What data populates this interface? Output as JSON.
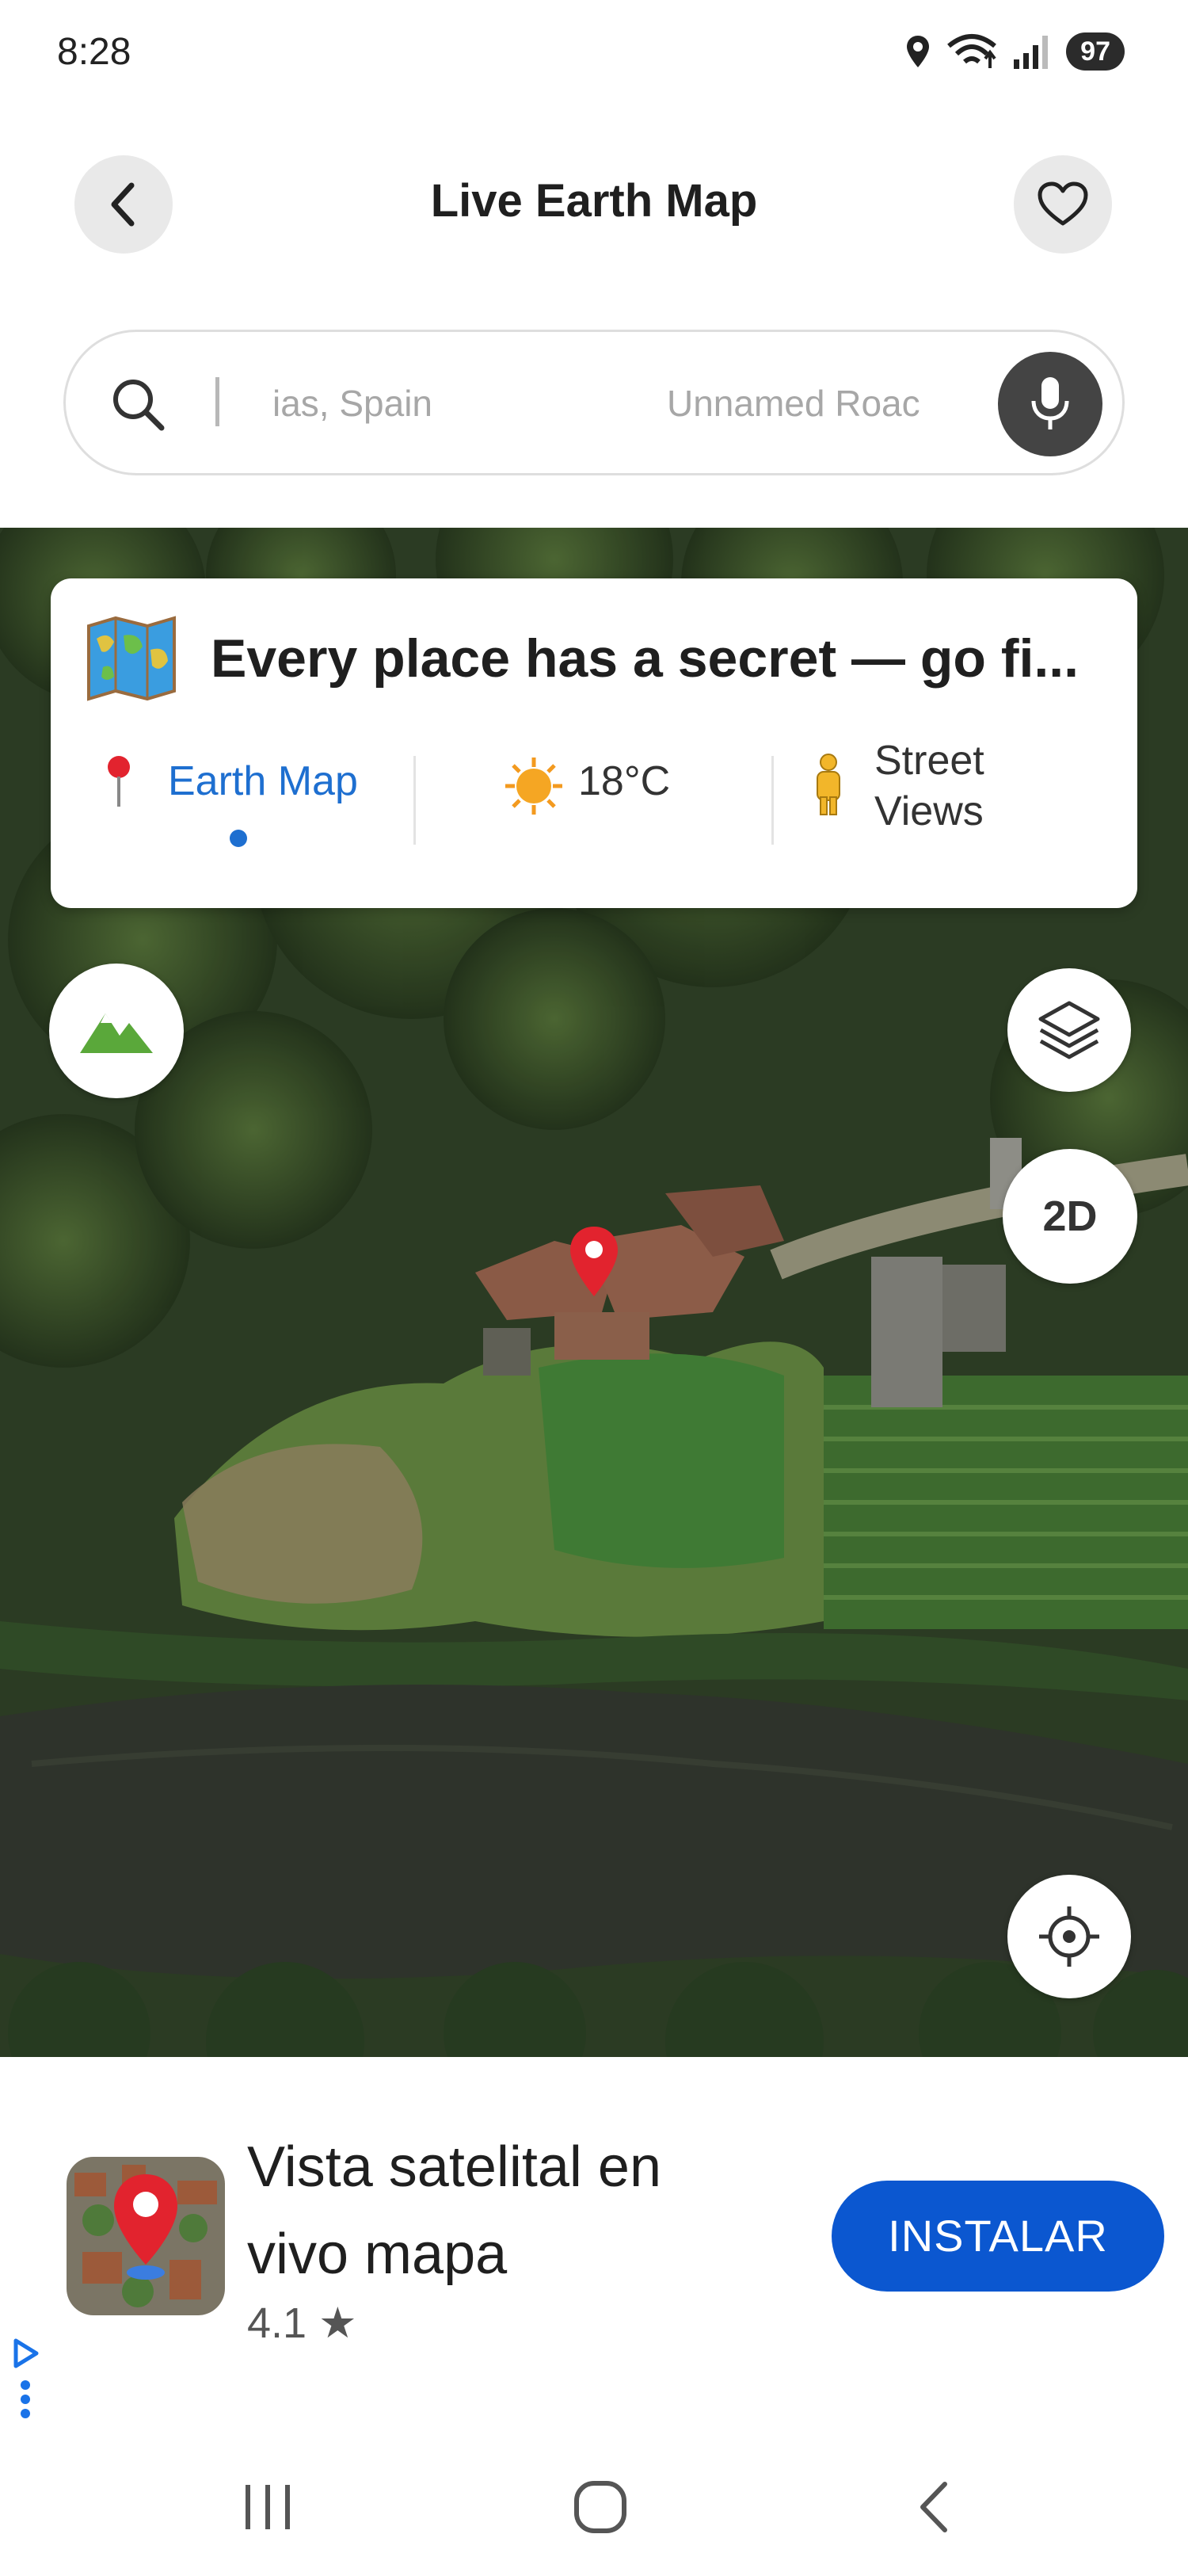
{
  "status_bar": {
    "time": "8:28",
    "battery": "97",
    "icons": [
      "location-icon",
      "wifi-icon",
      "signal-icon",
      "battery-icon"
    ]
  },
  "header": {
    "title": "Live Earth Map",
    "back_icon": "chevron-left-icon",
    "favorite_icon": "heart-icon"
  },
  "search": {
    "text_left": "ias, Spain",
    "text_right": "Unnamed Roac",
    "icon": "search-icon",
    "voice_icon": "mic-icon"
  },
  "info_card": {
    "title": "Every place has a secret — go fi...",
    "tabs": [
      {
        "label": "Earth Map",
        "icon": "pin-icon",
        "active": true
      },
      {
        "label": "18°C",
        "icon": "sun-icon",
        "active": false
      },
      {
        "label": "Street Views",
        "icon": "pegman-icon",
        "active": false
      }
    ],
    "accent_color": "#1e6fd0"
  },
  "map": {
    "mode_label": "2D",
    "marker_color": "#e2232e",
    "controls": [
      "terrain-icon",
      "layers-icon",
      "crosshair-icon"
    ]
  },
  "ad": {
    "title": "Vista satelital en vivo mapa",
    "rating": "4.1 ★",
    "cta": "INSTALAR",
    "cta_color": "#0b57d0"
  },
  "nav": {
    "icons": [
      "recent-apps-icon",
      "home-icon",
      "back-icon"
    ]
  }
}
